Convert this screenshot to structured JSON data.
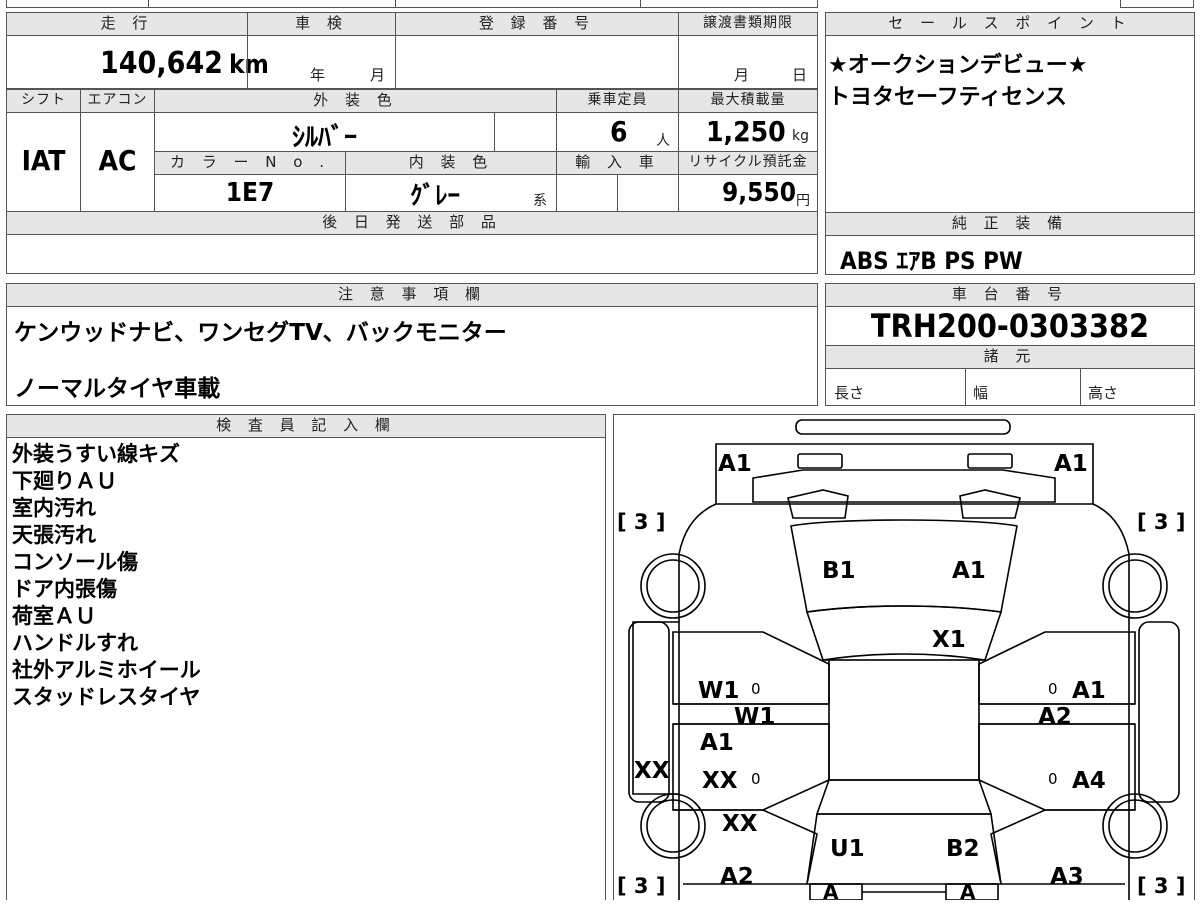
{
  "vehicle": {
    "mileage_label": "走 行",
    "mileage_value": "140,642",
    "mileage_unit": "km",
    "inspection_label": "車 検",
    "inspection_year_unit": "年",
    "inspection_month_unit": "月",
    "registration_label": "登 録 番 号",
    "transfer_deadline_label": "譲渡書類期限",
    "transfer_month_unit": "月",
    "transfer_day_unit": "日",
    "shift_label": "シフト",
    "shift_value": "IAT",
    "aircon_label": "エアコン",
    "aircon_value": "AC",
    "exterior_color_label": "外 装 色",
    "exterior_color_value": "ｼﾙﾊﾞｰ",
    "color_no_label": "カ ラ ー N o .",
    "color_no_value": "1E7",
    "interior_color_label": "内 装 色",
    "interior_color_value": "ｸﾞﾚｰ",
    "interior_color_suffix": "系",
    "capacity_label": "乗車定員",
    "capacity_value": "6",
    "capacity_unit": "人",
    "max_load_label": "最大積載量",
    "max_load_value": "1,250",
    "max_load_unit": "kg",
    "import_label": "輸 入 車",
    "recycle_label": "リサイクル預託金",
    "recycle_value": "9,550",
    "recycle_unit": "円",
    "later_parts_label": "後 日 発 送 部 品",
    "notes_label": "注 意 事 項 欄",
    "notes": [
      "ケンウッドナビ、ワンセグTV、バックモニター",
      "ノーマルタイヤ車載"
    ],
    "inspector_label": "検 査 員 記 入 欄",
    "inspector_notes": [
      "外装うすい線キズ",
      "下廻りＡＵ",
      "室内汚れ",
      "天張汚れ",
      "コンソール傷",
      "ドア内張傷",
      "荷室ＡＵ",
      "ハンドルすれ",
      "社外アルミホイール",
      "スタッドレスタイヤ"
    ]
  },
  "sales": {
    "label": "セ ー ル ス ポ イ ン ト",
    "lines": [
      "★オークションデビュー★",
      "トヨタセーフティセンス"
    ]
  },
  "equipment": {
    "label": "純 正 装 備",
    "value": "ABS ｴｱB PS PW"
  },
  "chassis": {
    "label": "車 台 番 号",
    "value": "TRH200-0303382",
    "spec_label": "諸 元",
    "length_label": "長さ",
    "width_label": "幅",
    "height_label": "高さ"
  },
  "damage_map": {
    "tire_tl": "[ 3 ]",
    "tire_tr": "[ 3 ]",
    "tire_bl": "[ 3 ]",
    "tire_br": "[ 3 ]",
    "front_left": "A1",
    "front_right": "A1",
    "hood_left": "B1",
    "hood_right": "A1",
    "roof_front": "X1",
    "left_front_door": "W1",
    "left_front_door_mark": "0",
    "left_sill": "W1",
    "left_rear_door": "A1",
    "left_rear_door_2": "XX",
    "left_rear_door_mark": "0",
    "left_outer": "XX",
    "left_rear_fender": "XX",
    "left_rear_corner": "A2",
    "right_front_door": "A1",
    "right_front_door_mark": "0",
    "right_sill": "A2",
    "right_rear_door": "A4",
    "right_rear_door_mark": "0",
    "right_rear_corner": "A3",
    "rear_left": "U1",
    "rear_right": "B2",
    "bumper_left": "A",
    "bumper_right": "A"
  }
}
